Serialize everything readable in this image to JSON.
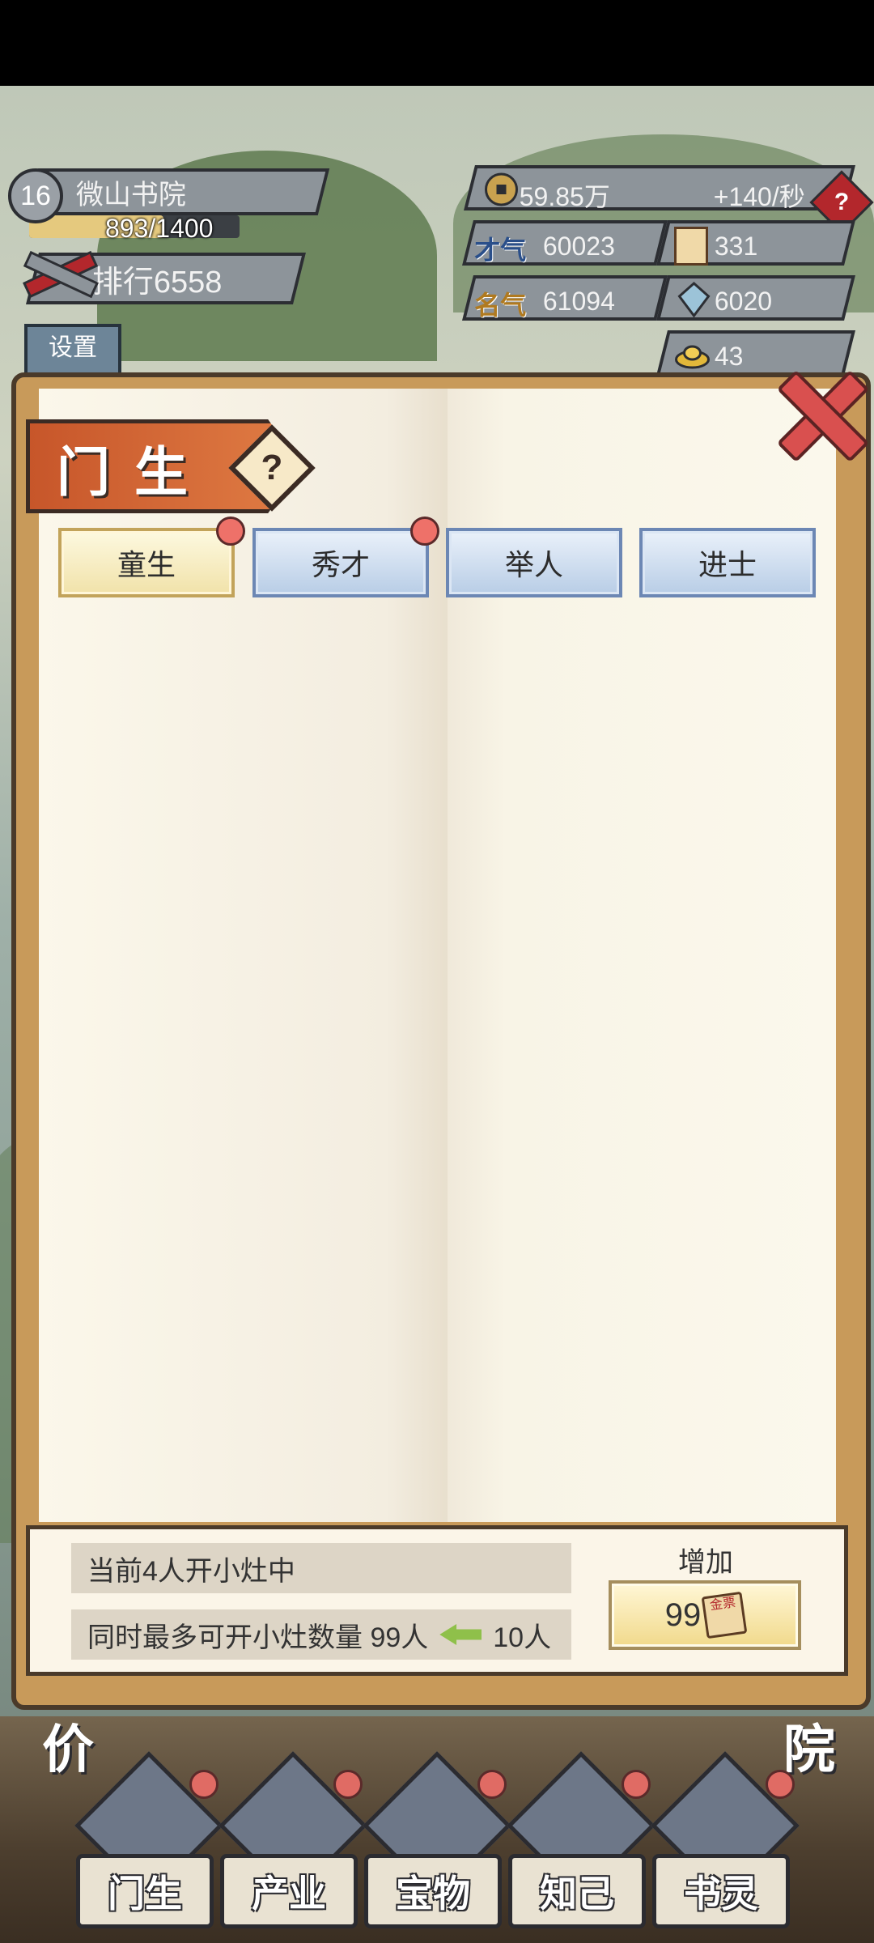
{
  "hud": {
    "level": "16",
    "school_name": "微山书院",
    "xp_text": "893/1400",
    "xp_fraction": 0.638,
    "rank_label": "排行6558",
    "settings_label": "设置",
    "coins": "59.85万",
    "coin_rate": "+140/秒",
    "talent_label": "才气",
    "talent_value": "60023",
    "gold_ticket_value": "331",
    "fame_label": "名气",
    "fame_value": "61094",
    "crystal_value": "6020",
    "ingot_value": "43"
  },
  "panel": {
    "title": "门生",
    "help_symbol": "?",
    "tabs": [
      {
        "label": "童生",
        "active": true,
        "dot": true
      },
      {
        "label": "秀才",
        "active": false,
        "dot": true
      },
      {
        "label": "举人",
        "active": false,
        "dot": false
      },
      {
        "label": "进士",
        "active": false,
        "dot": false
      }
    ],
    "current_status": "当前4人开小灶中",
    "max_prefix": "同时最多可开小灶数量 99人",
    "max_next": "10人",
    "add_label": "增加",
    "add_cost": "99",
    "ticket_text": "金票"
  },
  "nav": {
    "items": [
      "门生",
      "产业",
      "宝物",
      "知己",
      "书灵"
    ],
    "left_corner": "价",
    "right_corner": "院"
  },
  "colors": {
    "accent_orange": "#e07c44",
    "tab_active": "#f1e2a9",
    "tab_inactive": "#b8cde6",
    "badge_red": "#ee7169"
  }
}
